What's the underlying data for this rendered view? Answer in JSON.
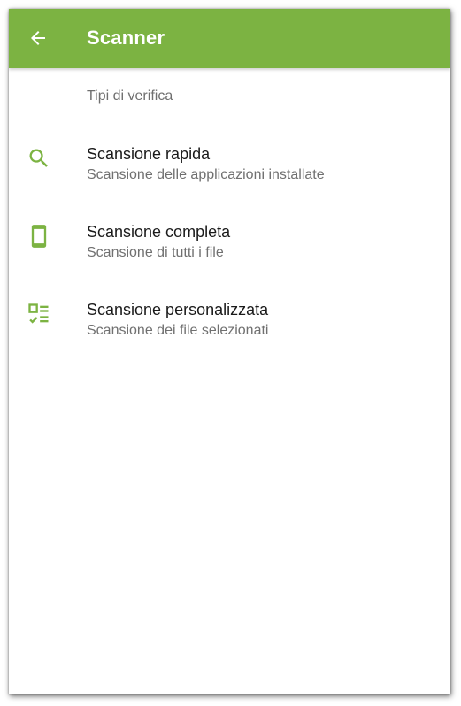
{
  "colors": {
    "accent": "#7cb342",
    "appbar_text": "#ffffff",
    "title_text": "#1a1a1a",
    "secondary_text": "#707070"
  },
  "appbar": {
    "back_icon": "arrow-back-icon",
    "title": "Scanner"
  },
  "section": {
    "header": "Tipi di verifica"
  },
  "items": [
    {
      "icon": "search-icon",
      "title": "Scansione rapida",
      "subtitle": "Scansione delle applicazioni installate"
    },
    {
      "icon": "smartphone-icon",
      "title": "Scansione completa",
      "subtitle": "Scansione di tutti i file"
    },
    {
      "icon": "checklist-icon",
      "title": "Scansione personalizzata",
      "subtitle": "Scansione dei file selezionati"
    }
  ]
}
